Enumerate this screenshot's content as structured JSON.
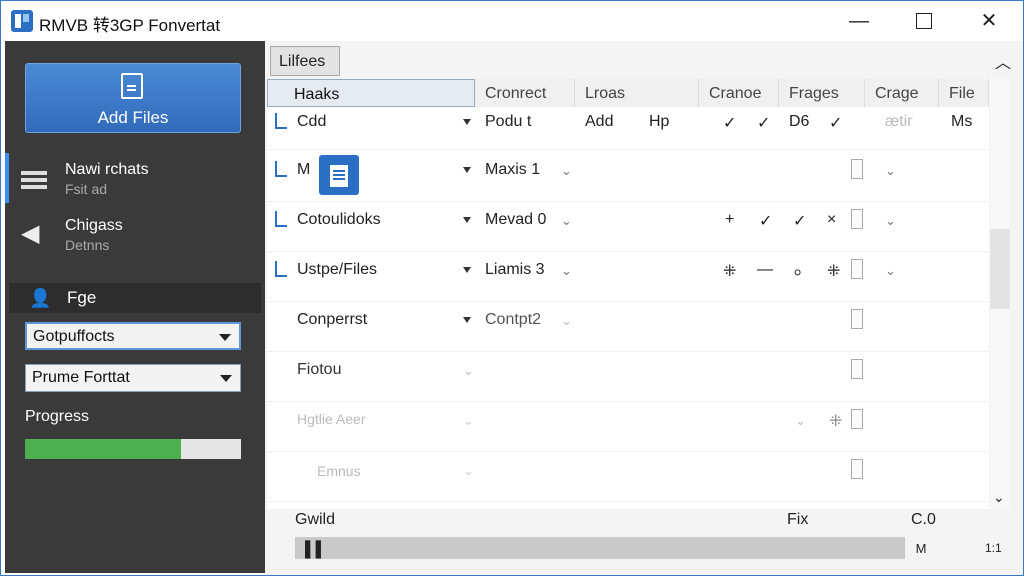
{
  "window": {
    "title": "RMVB 转3GP Fonvertat"
  },
  "sidebar": {
    "add_files": "Add Files",
    "nav": [
      {
        "label": "Nawi rchats",
        "sub": "Fsit ad"
      },
      {
        "label": "Chigass",
        "sub": "Detnns"
      }
    ],
    "section": "Fge",
    "dropdown1": "Gotpuffocts",
    "dropdown2": "Prume Forttat",
    "progress_label": "Progress",
    "progress": 0.72,
    "progress_color": "#4caf50"
  },
  "main": {
    "tab": "Lilfees",
    "columns": [
      "Haaks",
      "Cronrect",
      "Lroas",
      "Cranoe",
      "Frages",
      "Crage",
      "File"
    ],
    "rows": [
      {
        "name": "Cdd",
        "convert": "Podu t",
        "loras": "Add",
        "extra": "Hp",
        "c1": "✓",
        "c2": "✓",
        "frames": "D6",
        "c3": "✓",
        "crage": "ætir",
        "file": "Ms"
      },
      {
        "name": "M",
        "convert": "Maxis 1"
      },
      {
        "name": "Cotoulidoks",
        "convert": "Mevad 0",
        "c1": "+",
        "c2": "✓",
        "frames": "✓",
        "c3": "×"
      },
      {
        "name": "Ustpe/Files",
        "convert": "Liamis 3",
        "c1": "⁜",
        "c2": "—",
        "frames": "⸰",
        "c3": "⁜"
      },
      {
        "name": "Conperrst",
        "convert": "Contpt2"
      },
      {
        "name": "Fiotou"
      },
      {
        "name": "Hgtlie Aeer"
      },
      {
        "name": "Emnus"
      }
    ],
    "status": {
      "left": "Gwild",
      "mid": "Fix",
      "right": "C.0"
    },
    "hbar_right": "M",
    "zoom": "1:1"
  }
}
